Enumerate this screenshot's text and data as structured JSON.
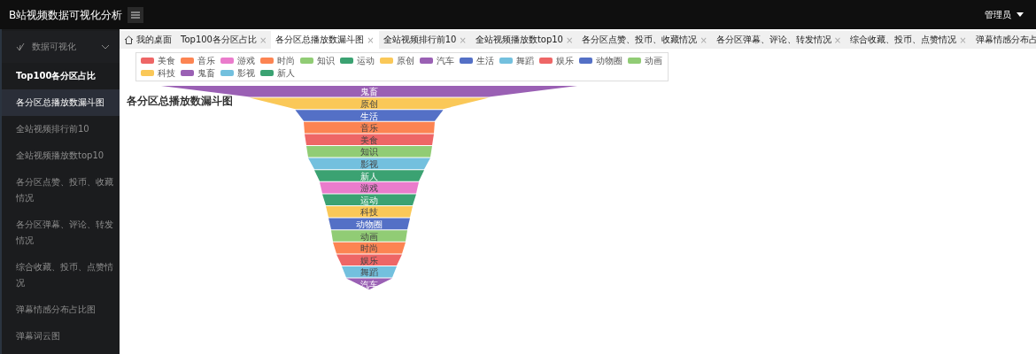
{
  "header": {
    "title": "B站视频数据可视化分析",
    "user": "管理员"
  },
  "sidebar": {
    "group": {
      "label": "数据可视化",
      "expanded": true
    },
    "items": [
      {
        "label": "Top100各分区占比",
        "selected": false,
        "emphasized": true
      },
      {
        "label": "各分区总播放数漏斗图",
        "selected": true,
        "emphasized": false
      },
      {
        "label": "全站视频排行前10",
        "selected": false,
        "emphasized": false
      },
      {
        "label": "全站视频播放数top10",
        "selected": false,
        "emphasized": false
      },
      {
        "label": "各分区点赞、投币、收藏情况",
        "selected": false,
        "emphasized": false
      },
      {
        "label": "各分区弹幕、评论、转发情况",
        "selected": false,
        "emphasized": false
      },
      {
        "label": "综合收藏、投币、点赞情况",
        "selected": false,
        "emphasized": false
      },
      {
        "label": "弹幕情感分布占比图",
        "selected": false,
        "emphasized": false
      },
      {
        "label": "弹幕词云图",
        "selected": false,
        "emphasized": false
      }
    ]
  },
  "tabs": [
    {
      "label": "我的桌面",
      "kind": "home",
      "selected": false
    },
    {
      "label": "Top100各分区占比",
      "kind": "closable",
      "close": "×",
      "selected": false
    },
    {
      "label": "各分区总播放数漏斗图",
      "kind": "closable",
      "close": "×",
      "selected": true
    },
    {
      "label": "全站视频排行前10",
      "kind": "closable",
      "close": "×",
      "selected": false
    },
    {
      "label": "全站视频播放数top10",
      "kind": "closable",
      "close": "×",
      "selected": false
    },
    {
      "label": "各分区点赞、投币、收藏情况",
      "kind": "closable",
      "close": "×",
      "selected": false
    },
    {
      "label": "各分区弹幕、评论、转发情况",
      "kind": "closable",
      "close": "×",
      "selected": false
    },
    {
      "label": "综合收藏、投币、点赞情况",
      "kind": "closable",
      "close": "×",
      "selected": false
    },
    {
      "label": "弹幕情感分布占",
      "kind": "plain",
      "selected": false
    }
  ],
  "chart": {
    "title": "各分区总播放数漏斗图",
    "legend": [
      {
        "label": "美食",
        "color": "#ee6666"
      },
      {
        "label": "音乐",
        "color": "#fc8452"
      },
      {
        "label": "游戏",
        "color": "#ea7ccc"
      },
      {
        "label": "时尚",
        "color": "#fc8452"
      },
      {
        "label": "知识",
        "color": "#91cc75"
      },
      {
        "label": "运动",
        "color": "#3ba272"
      },
      {
        "label": "原创",
        "color": "#fac858"
      },
      {
        "label": "汽车",
        "color": "#9a60b4"
      },
      {
        "label": "生活",
        "color": "#5470c6"
      },
      {
        "label": "舞蹈",
        "color": "#73c0de"
      },
      {
        "label": "娱乐",
        "color": "#ee6666"
      },
      {
        "label": "动物圈",
        "color": "#5470c6"
      },
      {
        "label": "动画",
        "color": "#91cc75"
      },
      {
        "label": "科技",
        "color": "#fac858"
      },
      {
        "label": "鬼畜",
        "color": "#9a60b4"
      },
      {
        "label": "影视",
        "color": "#73c0de"
      },
      {
        "label": "新人",
        "color": "#3ba272"
      }
    ],
    "segments": [
      {
        "label": "鬼畜",
        "color": "#9a60b4"
      },
      {
        "label": "原创",
        "color": "#fac858"
      },
      {
        "label": "生活",
        "color": "#5470c6"
      },
      {
        "label": "音乐",
        "color": "#fc8452"
      },
      {
        "label": "美食",
        "color": "#ee6666"
      },
      {
        "label": "知识",
        "color": "#91cc75"
      },
      {
        "label": "影视",
        "color": "#73c0de"
      },
      {
        "label": "新人",
        "color": "#3ba272"
      },
      {
        "label": "游戏",
        "color": "#ea7ccc"
      },
      {
        "label": "运动",
        "color": "#3ba272"
      },
      {
        "label": "科技",
        "color": "#fac858"
      },
      {
        "label": "动物圈",
        "color": "#5470c6"
      },
      {
        "label": "动画",
        "color": "#91cc75"
      },
      {
        "label": "时尚",
        "color": "#fc8452"
      },
      {
        "label": "娱乐",
        "color": "#ee6666"
      },
      {
        "label": "舞蹈",
        "color": "#73c0de"
      },
      {
        "label": "汽车",
        "color": "#9a60b4"
      }
    ]
  }
}
